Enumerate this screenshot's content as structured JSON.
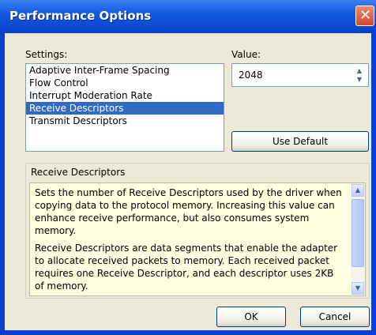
{
  "window": {
    "title": "Performance Options"
  },
  "settings": {
    "label": "Settings:",
    "items": [
      "Adaptive Inter-Frame Spacing",
      "Flow Control",
      "Interrupt Moderation Rate",
      "Receive Descriptors",
      "Transmit Descriptors"
    ],
    "selected_index": 3
  },
  "value": {
    "label": "Value:",
    "current": "2048"
  },
  "buttons": {
    "use_default": "Use Default",
    "ok": "OK",
    "cancel": "Cancel"
  },
  "description": {
    "heading": "Receive Descriptors",
    "paragraph1": "Sets the number of Receive Descriptors used by the driver when copying data to the protocol memory. Increasing this value can enhance receive performance, but also consumes system memory.",
    "paragraph2": "Receive Descriptors are data segments that enable the adapter to allocate received packets to memory. Each received packet requires one Receive Descriptor, and each descriptor uses 2KB of memory."
  }
}
